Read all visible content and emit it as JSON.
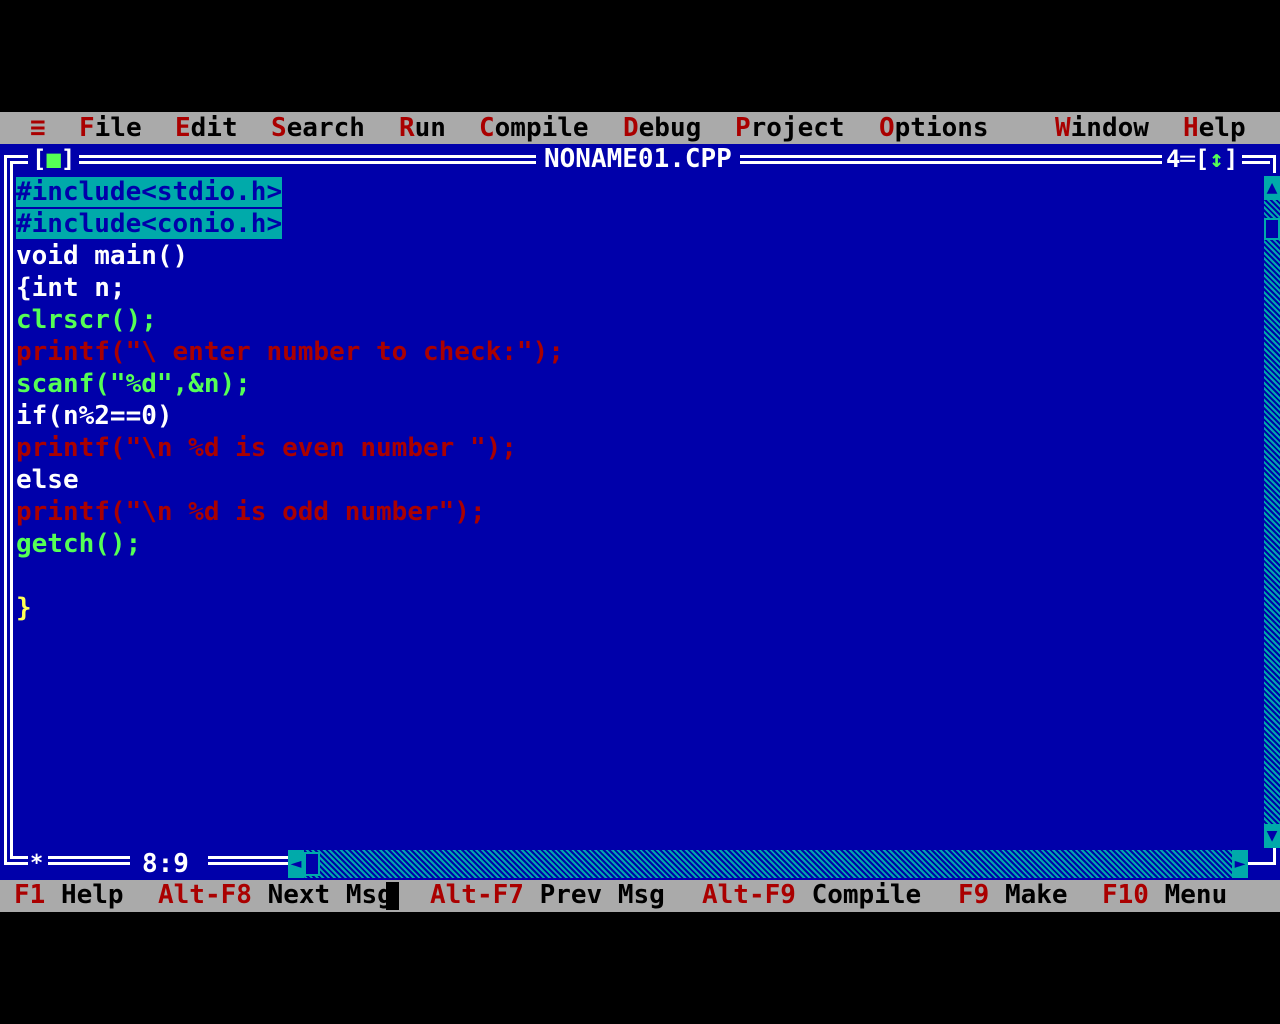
{
  "menu": {
    "system": "≡",
    "items": [
      {
        "hot": "F",
        "rest": "ile"
      },
      {
        "hot": "E",
        "rest": "dit"
      },
      {
        "hot": "S",
        "rest": "earch"
      },
      {
        "hot": "R",
        "rest": "un"
      },
      {
        "hot": "C",
        "rest": "ompile"
      },
      {
        "hot": "D",
        "rest": "ebug"
      },
      {
        "hot": "P",
        "rest": "roject"
      },
      {
        "hot": "O",
        "rest": "ptions"
      },
      {
        "hot": "W",
        "rest": "indow"
      },
      {
        "hot": "H",
        "rest": "elp"
      }
    ]
  },
  "window": {
    "title": "NONAME01.CPP",
    "close_box": "■",
    "number": "4",
    "zoom_icon": "↕",
    "position": "8:9",
    "modified_indicator": "*"
  },
  "code": {
    "lines": [
      "#include<stdio.h>",
      "#include<conio.h>",
      "void main()",
      "{int n;",
      "clrscr();",
      "printf(\"\\ enter number to check:\");",
      "scanf(\"%d\",&n);",
      "if(n%2==0)",
      "printf(\"\\n %d is even number \");",
      "else",
      "printf(\"\\n %d is odd number\");",
      "getch();",
      "",
      "}"
    ]
  },
  "status": {
    "items": [
      {
        "key": "F1",
        "label": " Help"
      },
      {
        "key": "Alt-F8",
        "label": " Next Msg"
      },
      {
        "key": "Alt-F7",
        "label": " Prev Msg"
      },
      {
        "key": "Alt-F9",
        "label": " Compile"
      },
      {
        "key": "F9",
        "label": " Make"
      },
      {
        "key": "F10",
        "label": " Menu"
      }
    ]
  },
  "colors": {
    "editor_bg": "#0000aa",
    "menu_bg": "#aaaaaa",
    "hotkey": "#aa0000",
    "selection": "#00aaaa",
    "function": "#55ff55",
    "punct": "#ffff55",
    "string": "#aa0000"
  }
}
